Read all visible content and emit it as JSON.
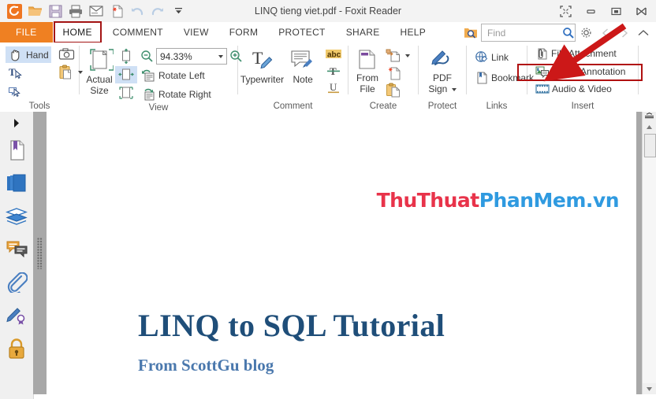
{
  "window": {
    "title": "LINQ tieng viet.pdf - Foxit Reader",
    "controls": [
      {
        "name": "fullscreen-button",
        "glyph": "⛶"
      },
      {
        "name": "minimize-button",
        "glyph": "—"
      },
      {
        "name": "restore-button",
        "glyph": "❐"
      },
      {
        "name": "close-button",
        "glyph": "✕"
      }
    ]
  },
  "quick_access": [
    {
      "name": "foxit-logo-icon",
      "label": "Foxit Reader"
    },
    {
      "name": "open-icon",
      "label": "Open"
    },
    {
      "name": "save-icon",
      "label": "Save"
    },
    {
      "name": "print-icon",
      "label": "Print"
    },
    {
      "name": "email-icon",
      "label": "Email"
    },
    {
      "name": "create-pdf-icon",
      "label": "Create PDF"
    },
    {
      "name": "undo-icon",
      "label": "Undo"
    },
    {
      "name": "redo-icon",
      "label": "Redo"
    },
    {
      "name": "customize-qat-icon",
      "label": "Customize Quick Access Toolbar"
    }
  ],
  "tabs": [
    {
      "label": "FILE",
      "id": "file",
      "selected": false
    },
    {
      "label": "HOME",
      "id": "home",
      "selected": true
    },
    {
      "label": "COMMENT",
      "id": "comment",
      "selected": false
    },
    {
      "label": "VIEW",
      "id": "view",
      "selected": false
    },
    {
      "label": "FORM",
      "id": "form",
      "selected": false
    },
    {
      "label": "PROTECT",
      "id": "protect",
      "selected": false
    },
    {
      "label": "SHARE",
      "id": "share",
      "selected": false
    },
    {
      "label": "HELP",
      "id": "help",
      "selected": false
    }
  ],
  "search": {
    "placeholder": "Find",
    "value": "",
    "advanced_search_icon": "advanced-search-icon",
    "settings_icon": "gear-icon",
    "prev_icon": "previous-page-icon",
    "next_icon": "next-page-icon",
    "collapse_icon": "collapse-ribbon-icon"
  },
  "ribbon": {
    "groups": [
      {
        "label": "Tools",
        "items": [
          {
            "label": "Hand",
            "name": "hand-tool-button",
            "highlighted": true
          },
          {
            "label": "",
            "name": "snapshot-tool-button",
            "highlighted": false
          },
          {
            "label": "",
            "name": "select-text-tool-button",
            "highlighted": false
          },
          {
            "label": "",
            "name": "clipboard-paste-button",
            "highlighted": false
          },
          {
            "label": "",
            "name": "select-annotation-tool-button",
            "highlighted": false
          }
        ]
      },
      {
        "label": "View",
        "actual_size": "Actual\nSize",
        "actual_size_line1": "Actual",
        "actual_size_line2": "Size",
        "zoom_value": "94.33%",
        "rotate_left": "Rotate Left",
        "rotate_right": "Rotate Right",
        "fit_page_icon": "fit-page-icon",
        "fit_width_icon": "fit-width-icon",
        "fit_visible_icon": "fit-visible-icon",
        "zoom_out_icon": "zoom-out-icon",
        "zoom_in_icon": "zoom-in-icon"
      },
      {
        "label": "Comment",
        "typewriter": "Typewriter",
        "note": "Note",
        "highlight_icon": "abc-highlight-icon",
        "strikeout_icon": "strikeout-icon",
        "underline_icon": "underline-icon"
      },
      {
        "label": "Create",
        "from_file_line1": "From",
        "from_file_line2": "File",
        "from_scanner_icon": "from-scanner-icon",
        "blank_page_icon": "blank-page-icon",
        "from_clipboard_icon": "from-clipboard-icon"
      },
      {
        "label": "Protect",
        "pdf_sign_line1": "PDF",
        "pdf_sign_line2": "Sign",
        "pdf_sign_icon": "pdf-sign-icon"
      },
      {
        "label": "Links",
        "link": "Link",
        "bookmark": "Bookmark",
        "link_icon": "link-icon",
        "bookmark_icon": "bookmark-icon"
      },
      {
        "label": "Insert",
        "file_attachment": "File Attachment",
        "image_annotation": "Image Annotation",
        "audio_video": "Audio & Video",
        "file_attachment_icon": "file-attachment-icon",
        "image_annotation_icon": "image-annotation-icon",
        "audio_video_icon": "audio-video-icon",
        "highlighted_item": "Image Annotation"
      }
    ]
  },
  "sidebar": {
    "items": [
      {
        "name": "expand-panel-arrow-icon",
        "label": "Expand"
      },
      {
        "name": "bookmarks-panel-icon",
        "label": "Bookmarks"
      },
      {
        "name": "pages-panel-icon",
        "label": "Page Thumbnails"
      },
      {
        "name": "layers-panel-icon",
        "label": "Layers"
      },
      {
        "name": "comments-panel-icon",
        "label": "Comments"
      },
      {
        "name": "attachments-panel-icon",
        "label": "Attachments"
      },
      {
        "name": "signatures-panel-icon",
        "label": "Digital Signatures"
      },
      {
        "name": "security-panel-icon",
        "label": "Security"
      }
    ]
  },
  "document": {
    "watermark_part1": "ThuThuat",
    "watermark_part2": "PhanMem.vn",
    "watermark_color1": "#e8334a",
    "watermark_color2": "#2f9ae0",
    "title": "LINQ to SQL Tutorial",
    "subtitle": "From ScottGu blog",
    "title_color": "#1f4e79",
    "subtitle_color": "#4a78ad"
  },
  "annotation": {
    "arrow_color": "#cc1818",
    "arrow_label": "red-pointer-arrow",
    "highlight_color": "#b01010"
  }
}
